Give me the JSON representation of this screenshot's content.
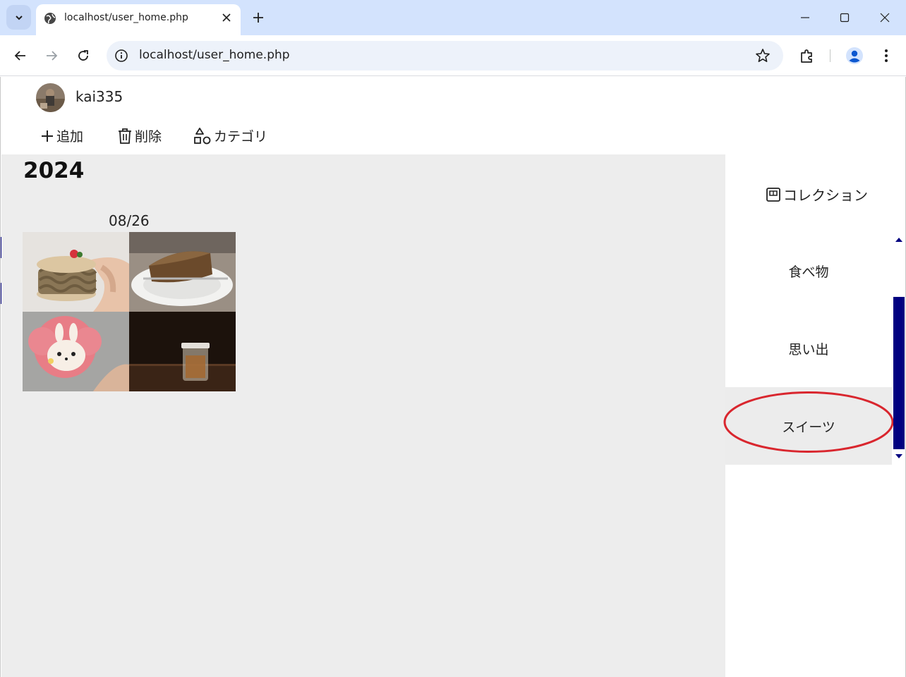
{
  "browser": {
    "tab_title": "localhost/user_home.php",
    "url": "localhost/user_home.php"
  },
  "user": {
    "name": "kai335"
  },
  "actions": {
    "add_label": "追加",
    "delete_label": "削除",
    "category_label": "カテゴリ"
  },
  "timeline": {
    "year": "2024",
    "groups": [
      {
        "date": "08/26",
        "photos": [
          "sweets-macaron-photo",
          "sweets-cake-photo",
          "sweets-bunny-cookie-photo",
          "sweets-jar-photo"
        ]
      }
    ]
  },
  "sidebar": {
    "collection_label": "コレクション",
    "categories": [
      {
        "label": "食べ物",
        "selected": false
      },
      {
        "label": "思い出",
        "selected": false
      },
      {
        "label": "スイーツ",
        "selected": true
      }
    ]
  },
  "colors": {
    "chrome_bg": "#d3e3fd",
    "content_bg": "#ededed",
    "scrollbar": "#000080",
    "annotation": "#d9262e"
  }
}
